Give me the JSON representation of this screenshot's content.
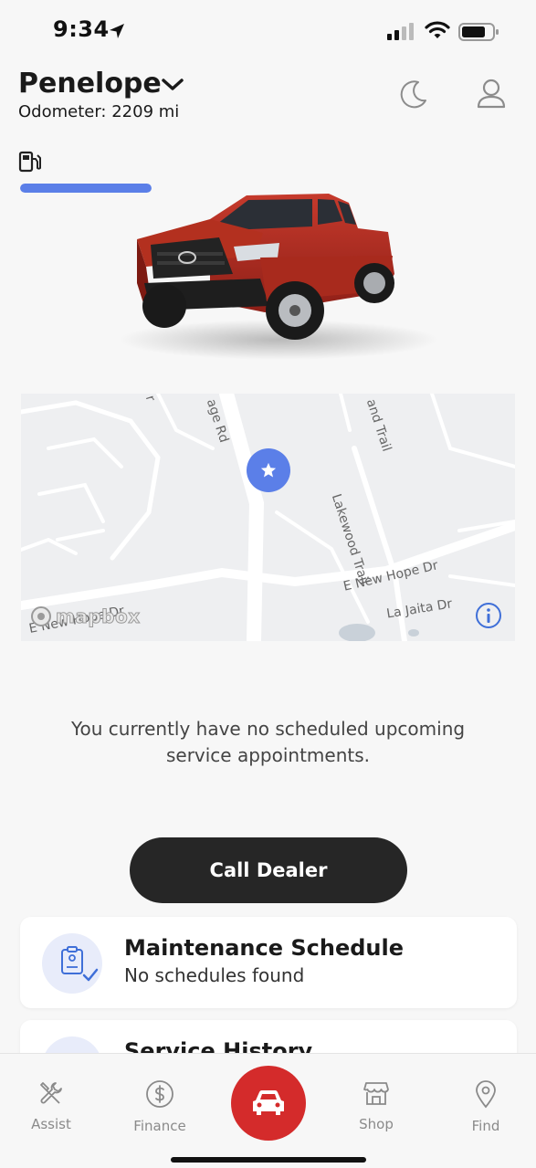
{
  "status_bar": {
    "time": "9:34"
  },
  "header": {
    "vehicle_name": "Penelope",
    "odometer": "Odometer: 2209 mi"
  },
  "fuel": {
    "level_percent": 100,
    "color": "#5b7fe8"
  },
  "map": {
    "labels": [
      "Lakewood Trail",
      "E New Hope Dr",
      "La Jaita Dr",
      "E New Hope Dr",
      "age Rd",
      "and Trail",
      "r"
    ],
    "attribution": "mapbox",
    "pin_color": "#5b7fe8"
  },
  "service": {
    "message": "You currently have no scheduled upcoming service appointments."
  },
  "actions": {
    "call_dealer": "Call Dealer"
  },
  "cards": [
    {
      "title": "Maintenance Schedule",
      "subtitle": "No schedules found"
    },
    {
      "title": "Service History",
      "subtitle": ""
    }
  ],
  "tabs": [
    {
      "label": "Assist",
      "icon": "tools-icon"
    },
    {
      "label": "Finance",
      "icon": "dollar-icon"
    },
    {
      "label": "",
      "icon": "car-icon"
    },
    {
      "label": "Shop",
      "icon": "store-icon"
    },
    {
      "label": "Find",
      "icon": "location-pin-icon"
    }
  ],
  "colors": {
    "accent": "#5b7fe8",
    "brand_red": "#d42b2b",
    "button_dark": "#262626"
  }
}
